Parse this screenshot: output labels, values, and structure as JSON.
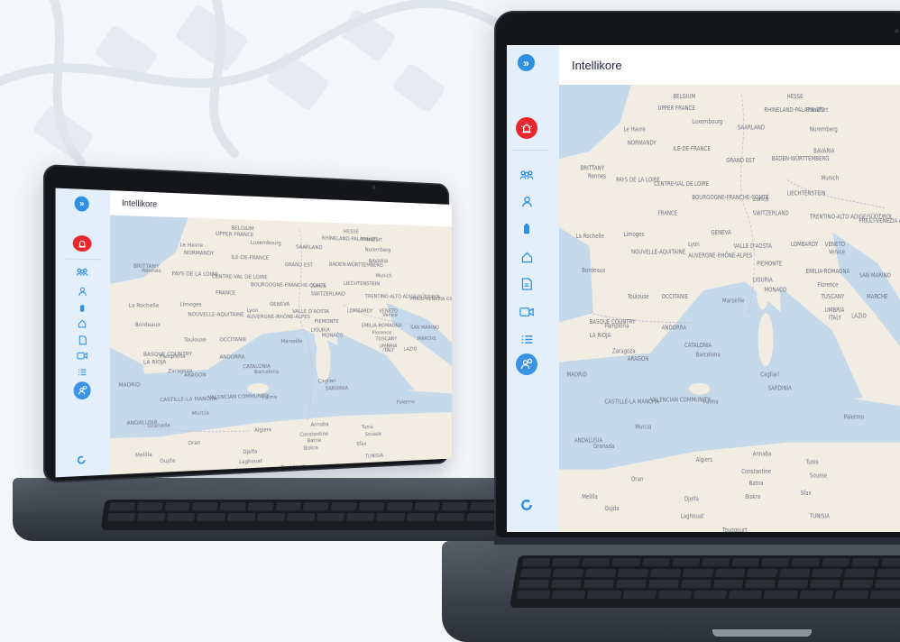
{
  "app": {
    "title": "Intellikore"
  },
  "sidebar": {
    "expand_icon": "chevrons-right-icon",
    "alert_icon": "alarm-siren-icon",
    "items": [
      {
        "name": "groups",
        "icon": "users-group-icon"
      },
      {
        "name": "person",
        "icon": "user-icon"
      },
      {
        "name": "battery",
        "icon": "battery-icon"
      },
      {
        "name": "home",
        "icon": "home-icon"
      },
      {
        "name": "document",
        "icon": "document-icon"
      },
      {
        "name": "camera",
        "icon": "video-camera-icon"
      },
      {
        "name": "list",
        "icon": "list-icon"
      }
    ],
    "active_item": {
      "name": "contacts",
      "icon": "user-location-icon"
    },
    "footer_icon": "refresh-icon"
  },
  "colors": {
    "accent": "#2f8fe0",
    "alert": "#e8262b",
    "sidebar_bg": "#e3f0fb",
    "land": "#f2ede3",
    "sea": "#c6d9ea"
  },
  "map": {
    "labels": [
      "BELGIUM",
      "HESSE",
      "UPPER FRANCE",
      "RHINELAND-PALATINATE",
      "Frankfurt",
      "Le Havre",
      "Luxembourg",
      "SAARLAND",
      "Nuremberg",
      "NORMANDY",
      "ILE-DE-FRANCE",
      "GRAND EST",
      "BADEN-WÜRTTEMBERG",
      "BAVARIA",
      "BRITTANY",
      "Rennes",
      "PAYS DE LA LOIRE",
      "CENTRE-VAL DE LOIRE",
      "BOURGOGNE-FRANCHE-COMTÉ",
      "Munich",
      "Zurich",
      "LIECHTENSTEIN",
      "FRANCE",
      "SWITZERLAND",
      "TRENTINO-ALTO ADIGE/SÜDTIROL",
      "FRIULI-VENEZIA GIULIA",
      "La Rochelle",
      "Limoges",
      "GENEVA",
      "Lyon",
      "AUVERGNE-RHÔNE-ALPES",
      "VALLE D'AOSTA",
      "LOMBARDY",
      "VENETO",
      "Venice",
      "NOUVELLE-AQUITAINE",
      "PIEMONTE",
      "Bordeaux",
      "LIGURIA",
      "EMILIA-ROMAGNA",
      "SAN MARINO",
      "Florence",
      "TUSCANY",
      "MARCHE",
      "UMBRIA",
      "ITALY",
      "LAZIO",
      "Toulouse",
      "OCCITANIE",
      "Marseille",
      "MONACO",
      "BASQUE COUNTRY",
      "Pamplona",
      "ANDORRA",
      "LA RIOJA",
      "CATALONIA",
      "Zaragoza",
      "ARAGON",
      "Barcelona",
      "MADRID",
      "CASTILLE-LA MANCHA",
      "VALENCIAN COMMUNITY",
      "Palma",
      "Cagliari",
      "SARDINIA",
      "Murcia",
      "Palermo",
      "ANDALUSIA",
      "Granada",
      "Algiers",
      "Annaba",
      "Tunis",
      "Constantine",
      "Oran",
      "Batna",
      "Sousse",
      "Biskra",
      "Djelfa",
      "Sfax",
      "TUNISIA",
      "Laghouat",
      "Touggourt",
      "Melilla",
      "Oujda"
    ]
  }
}
